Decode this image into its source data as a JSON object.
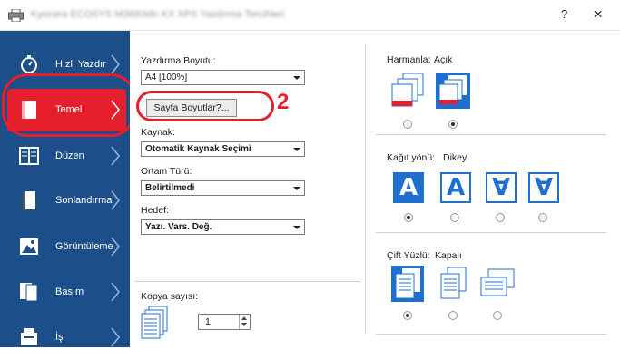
{
  "window": {
    "title": "Kyocera ECOSYS M3660idn KX XPS Yazdırma Tercihleri",
    "help": "?",
    "close": "×"
  },
  "sidebar": {
    "items": [
      {
        "label": "Hızlı Yazdır",
        "icon": "stopwatch-icon"
      },
      {
        "label": "Temel",
        "icon": "page-icon",
        "active": true
      },
      {
        "label": "Düzen",
        "icon": "layout-icon"
      },
      {
        "label": "Sonlandırma",
        "icon": "finishing-icon"
      },
      {
        "label": "Görüntüleme",
        "icon": "image-icon"
      },
      {
        "label": "Basım",
        "icon": "publishing-icon"
      },
      {
        "label": "İş",
        "icon": "job-icon"
      }
    ]
  },
  "basic": {
    "print_size_label": "Yazdırma Boyutu:",
    "print_size_value": "A4 [100%]",
    "page_sizes_button": "Sayfa Boyutlar?...",
    "callout_number": "2",
    "source_label": "Kaynak:",
    "source_value": "Otomatik Kaynak Seçimi",
    "media_label": "Ortam Türü:",
    "media_value": "Belirtilmedi",
    "dest_label": "Hedef:",
    "dest_value": "Yazı. Vars. Değ.",
    "copies_label": "Kopya sayısı:",
    "copies_value": "1"
  },
  "collate": {
    "label": "Harmanla:",
    "value": "Açık",
    "selected_index": 1
  },
  "orientation": {
    "label": "Kağıt yönü:",
    "value": "Dikey",
    "glyphs": [
      "A",
      "A",
      "∀",
      "∀"
    ],
    "selected_index": 0
  },
  "duplex": {
    "label": "Çift Yüzlü:",
    "value": "Kapalı",
    "selected_index": 0
  },
  "colors": {
    "sidebar": "#1c4f89",
    "accent": "#e5202c",
    "blue": "#1f6fd0"
  }
}
